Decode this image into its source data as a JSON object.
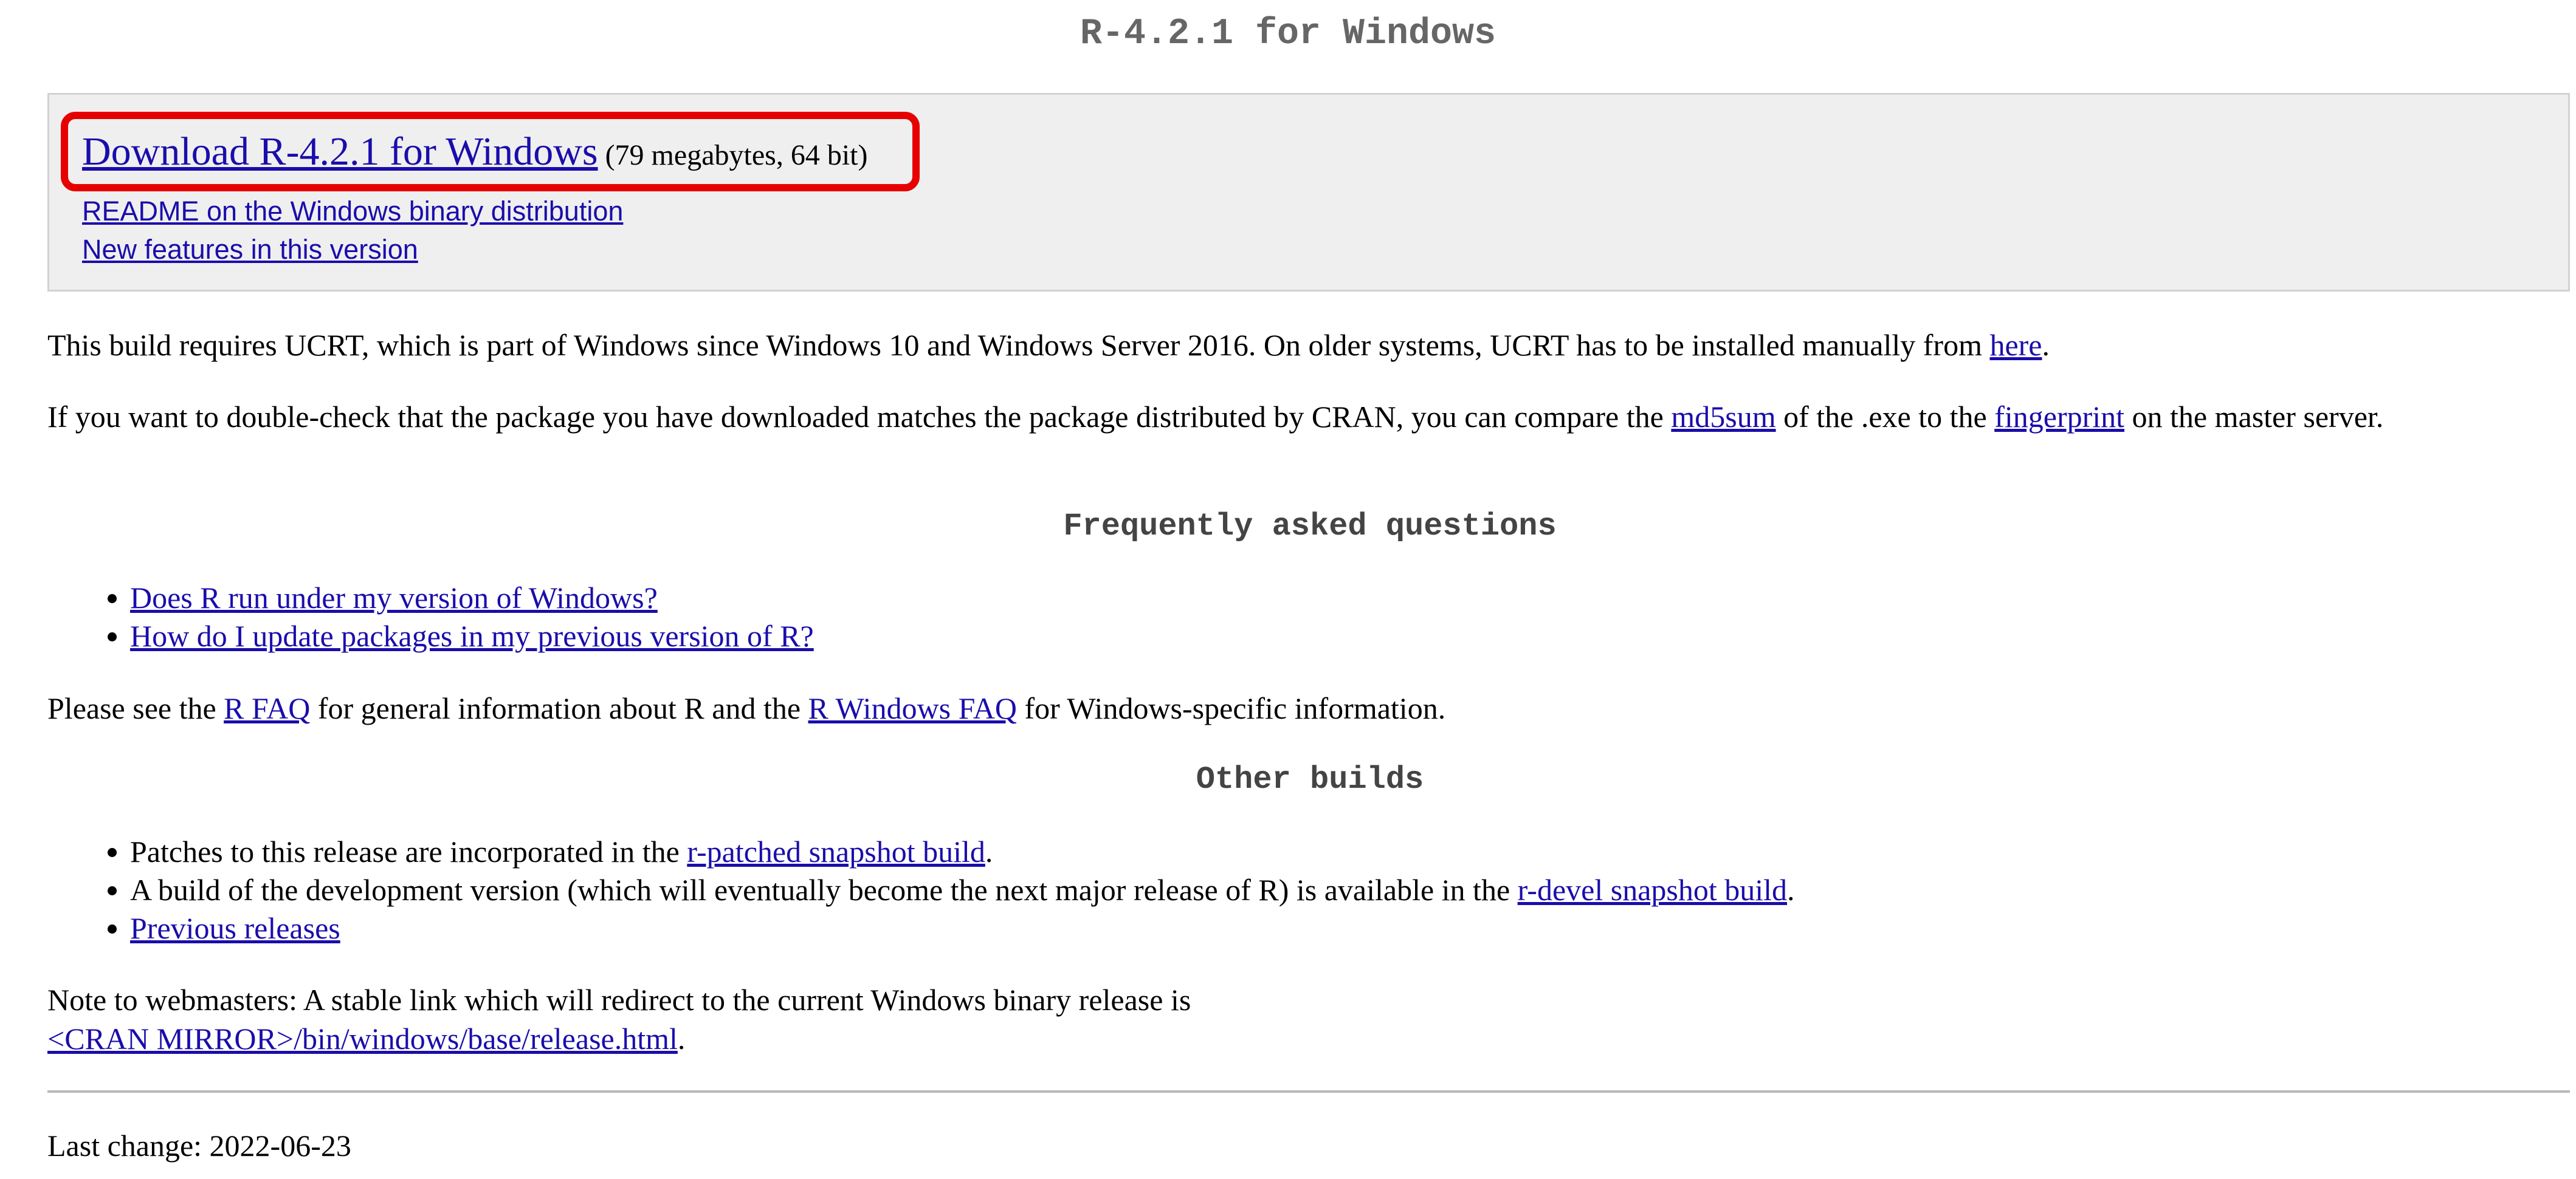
{
  "page_title": "R-4.2.1 for Windows",
  "download": {
    "link_label": "Download R-4.2.1 for Windows",
    "size_note": "(79 megabytes, 64 bit)",
    "readme_label": "README on the Windows binary distribution",
    "new_features_label": "New features in this version"
  },
  "ucrt": {
    "text_before": "This build requires UCRT, which is part of Windows since Windows 10 and Windows Server 2016. On older systems, UCRT has to be installed manually from ",
    "link_label": "here",
    "text_after": "."
  },
  "checksum": {
    "text_1": "If you want to double-check that the package you have downloaded matches the package distributed by CRAN, you can compare the ",
    "md5sum_label": "md5sum",
    "text_2": " of the .exe to the ",
    "fingerprint_label": "fingerprint",
    "text_3": " on the master server."
  },
  "faq": {
    "heading": "Frequently asked questions",
    "items": [
      "Does R run under my version of Windows?",
      "How do I update packages in my previous version of R?"
    ],
    "see_text_1": "Please see the ",
    "rfaq_label": "R FAQ",
    "see_text_2": " for general information about R and the ",
    "rwinfaq_label": "R Windows FAQ",
    "see_text_3": " for Windows-specific information."
  },
  "other_builds": {
    "heading": "Other builds",
    "patches_text": "Patches to this release are incorporated in the ",
    "patched_link": "r-patched snapshot build",
    "patches_after": ".",
    "devel_text": "A build of the development version (which will eventually become the next major release of R) is available in the ",
    "devel_link": "r-devel snapshot build",
    "devel_after": ".",
    "previous_link": "Previous releases"
  },
  "webmasters": {
    "note": "Note to webmasters: A stable link which will redirect to the current Windows binary release is",
    "link_label": "<CRAN MIRROR>/bin/windows/base/release.html",
    "after": "."
  },
  "footer": {
    "last_change": "Last change: 2022-06-23"
  },
  "colors": {
    "link": "#1a0dab",
    "highlight_border": "#e60000",
    "box_background": "#efefef"
  }
}
